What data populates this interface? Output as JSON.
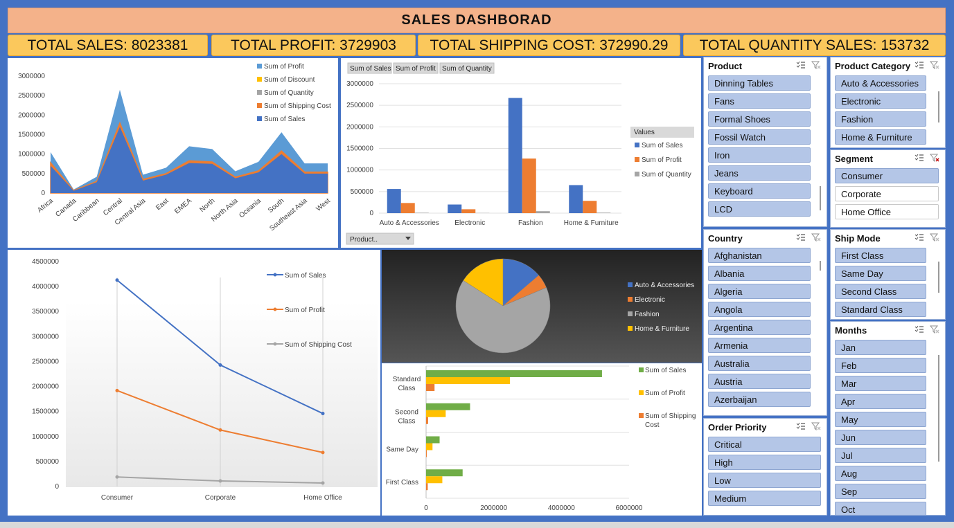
{
  "title": "SALES  DASHBORAD",
  "kpis": [
    {
      "label": "TOTAL SALES: 8023381"
    },
    {
      "label": "TOTAL PROFIT: 3729903"
    },
    {
      "label": "TOTAL SHIPPING COST: 372990.29"
    },
    {
      "label": "TOTAL QUANTITY SALES: 153732"
    }
  ],
  "colors": {
    "blue": "#4472c4",
    "orange": "#ed7d31",
    "gray": "#a5a5a5",
    "yellow": "#ffc000",
    "lightblue": "#5b9bd5",
    "green": "#70ad47"
  },
  "chart_data": [
    {
      "type": "area",
      "categories": [
        "Africa",
        "Canada",
        "Caribbean",
        "Central",
        "Central Asia",
        "East",
        "EMEA",
        "North",
        "North Asia",
        "Oceania",
        "South",
        "Southeast Asia",
        "West"
      ],
      "ylim": [
        0,
        3000000
      ],
      "yticks": [
        "3000000",
        "2500000",
        "2000000",
        "1500000",
        "1000000",
        "500000",
        "0"
      ],
      "series": [
        {
          "name": "Sum of Profit",
          "values": [
            1050000,
            90000,
            420000,
            2650000,
            470000,
            650000,
            1200000,
            1130000,
            560000,
            800000,
            1560000,
            760000,
            760000
          ]
        },
        {
          "name": "Sum of Discount",
          "values": [
            0,
            0,
            0,
            0,
            0,
            0,
            0,
            0,
            0,
            0,
            0,
            0,
            0
          ]
        },
        {
          "name": "Sum of Quantity",
          "values": [
            30000,
            3000,
            12000,
            50000,
            9000,
            14000,
            25000,
            22000,
            10000,
            16000,
            30000,
            15000,
            15000
          ]
        },
        {
          "name": "Sum of Shipping Cost",
          "values": [
            780000,
            65000,
            300000,
            1800000,
            350000,
            500000,
            830000,
            800000,
            410000,
            570000,
            1080000,
            540000,
            540000
          ]
        },
        {
          "name": "Sum of Sales",
          "values": [
            700000,
            60000,
            280000,
            1700000,
            320000,
            470000,
            770000,
            750000,
            380000,
            530000,
            1000000,
            500000,
            500000
          ]
        }
      ]
    },
    {
      "type": "bar",
      "buttons": [
        "Sum of Sales",
        "Sum of Profit",
        "Sum of Quantity"
      ],
      "filter": "Product..",
      "legend_title": "Values",
      "categories": [
        "Auto & Accessories",
        "Electronic",
        "Fashion",
        "Home & Furniture"
      ],
      "ylim": [
        0,
        3000000
      ],
      "yticks": [
        "3000000",
        "2500000",
        "2000000",
        "1500000",
        "1000000",
        "500000",
        "0"
      ],
      "series": [
        {
          "name": "Sum of Sales",
          "values": [
            560000,
            200000,
            2670000,
            650000
          ]
        },
        {
          "name": "Sum of Profit",
          "values": [
            235000,
            90000,
            1265000,
            285000
          ]
        },
        {
          "name": "Sum of Quantity",
          "values": [
            10000,
            4000,
            45000,
            12000
          ]
        }
      ]
    },
    {
      "type": "line",
      "categories": [
        "Consumer",
        "Corporate",
        "Home Office"
      ],
      "ylim": [
        0,
        4500000
      ],
      "yticks": [
        "4500000",
        "4000000",
        "3500000",
        "3000000",
        "2500000",
        "2000000",
        "1500000",
        "1000000",
        "500000",
        "0"
      ],
      "series": [
        {
          "name": "Sum of Sales",
          "values": [
            4130000,
            2430000,
            1460000
          ]
        },
        {
          "name": "Sum of Profit",
          "values": [
            1920000,
            1130000,
            680000
          ]
        },
        {
          "name": "Sum of Shipping Cost",
          "values": [
            190000,
            110000,
            70000
          ]
        }
      ]
    },
    {
      "type": "pie",
      "categories": [
        "Auto & Accessories",
        "Electronic",
        "Fashion",
        "Home & Furniture"
      ],
      "values": [
        560000,
        200000,
        2670000,
        650000
      ]
    },
    {
      "type": "bar",
      "orientation": "horizontal",
      "categories": [
        "Standard Class",
        "Second Class",
        "Same Day",
        "First Class"
      ],
      "xlim": [
        0,
        6000000
      ],
      "xticks": [
        "0",
        "2000000",
        "4000000",
        "6000000"
      ],
      "series": [
        {
          "name": "Sum of Sales",
          "values": [
            5200000,
            1300000,
            400000,
            1080000
          ]
        },
        {
          "name": "Sum of Profit",
          "values": [
            2480000,
            580000,
            190000,
            480000
          ]
        },
        {
          "name": "Sum of Shipping Cost",
          "values": [
            250000,
            60000,
            20000,
            50000
          ]
        }
      ]
    }
  ],
  "slicers": [
    {
      "title": "Product",
      "items": [
        "Dinning Tables",
        "Fans",
        "Formal Shoes",
        "Fossil Watch",
        "Iron",
        "Jeans",
        "Keyboard",
        "LCD"
      ]
    },
    {
      "title": "Product Category",
      "items": [
        "Auto & Accessories",
        "Electronic",
        "Fashion",
        "Home & Furniture"
      ]
    },
    {
      "title": "Segment",
      "items": [
        "Consumer",
        "Corporate",
        "Home Office"
      ]
    },
    {
      "title": "Country",
      "items": [
        "Afghanistan",
        "Albania",
        "Algeria",
        "Angola",
        "Argentina",
        "Armenia",
        "Australia",
        "Austria",
        "Azerbaijan"
      ]
    },
    {
      "title": "Ship Mode",
      "items": [
        "First Class",
        "Same Day",
        "Second Class",
        "Standard Class"
      ]
    },
    {
      "title": "Months",
      "items": [
        "Jan",
        "Feb",
        "Mar",
        "Apr",
        "May",
        "Jun",
        "Jul",
        "Aug",
        "Sep",
        "Oct"
      ]
    },
    {
      "title": "Order Priority",
      "items": [
        "Critical",
        "High",
        "Low",
        "Medium"
      ]
    }
  ]
}
